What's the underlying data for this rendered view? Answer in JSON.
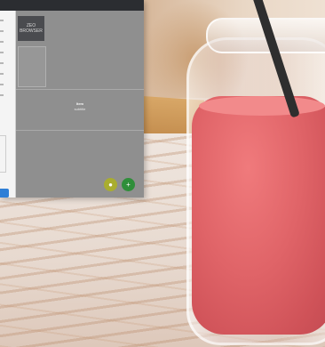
{
  "window": {
    "logo_line1": "ZEO",
    "logo_line2": "BROWSER",
    "center_title": "Item",
    "center_subtitle": "subtitle"
  },
  "actions": {
    "olive_icon": "circle-icon",
    "green_icon": "plus-icon",
    "green_label": "+"
  },
  "colors": {
    "titlebar": "#2b2d31",
    "panel": "#8f8f8f",
    "accent_blue": "#2f7fd6",
    "olive": "#a9ad2f",
    "green": "#2f8e3a",
    "smoothie": "#e06468"
  }
}
